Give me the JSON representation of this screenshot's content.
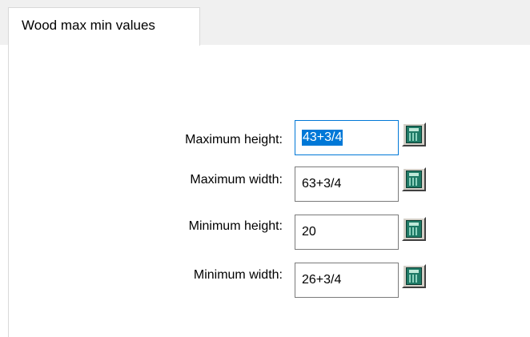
{
  "tabs": [
    {
      "label": "Wood max min values",
      "selected": true
    }
  ],
  "fields": [
    {
      "label": "Maximum height:",
      "value": "43+3/4",
      "focused": true,
      "selected": true,
      "button_icon": "calculator-icon"
    },
    {
      "label": "Maximum width:",
      "value": "63+3/4",
      "focused": false,
      "selected": false,
      "button_icon": "calculator-icon"
    },
    {
      "label": "Minimum height:",
      "value": "20",
      "focused": false,
      "selected": false,
      "button_icon": "calculator-icon"
    },
    {
      "label": "Minimum width:",
      "value": "26+3/4",
      "focused": false,
      "selected": false,
      "button_icon": "calculator-icon"
    }
  ],
  "colors": {
    "selection": "#0078d7",
    "tab_strip": "#f0f0f0",
    "calculator": "#1f7a66"
  }
}
